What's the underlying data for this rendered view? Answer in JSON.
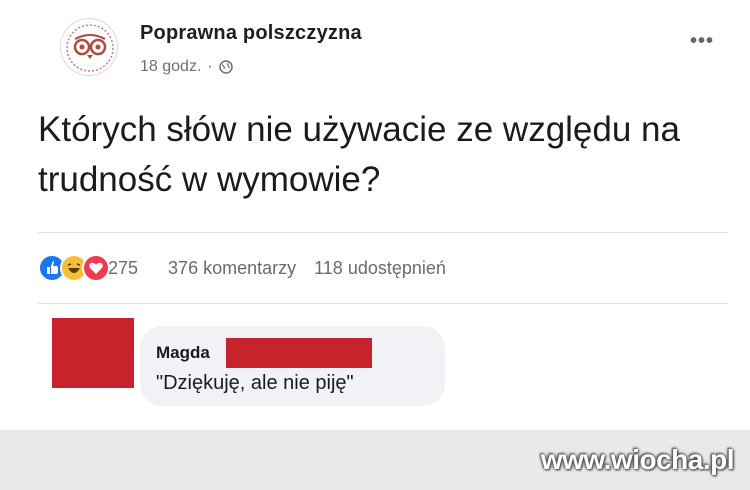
{
  "post": {
    "page_name": "Poprawna polszczyzna",
    "time": "18 godz.",
    "separator": "·",
    "more": "•••",
    "text": "Których słów nie używacie ze względu na trudność w wymowie?"
  },
  "reactions": {
    "icons": [
      "like-icon",
      "haha-icon",
      "love-icon"
    ],
    "count": "275",
    "comments": "376 komentarzy",
    "shares": "118 udostępnień"
  },
  "comment": {
    "author": "Magda",
    "text": "\"Dziękuję, ale nie piję\""
  },
  "watermark": "www.wiocha.pl",
  "colors": {
    "like": "#1877f2",
    "haha": "#f7c034",
    "love": "#ef3a52",
    "redaction": "#c8232c",
    "bubble": "#f0f2f5"
  }
}
